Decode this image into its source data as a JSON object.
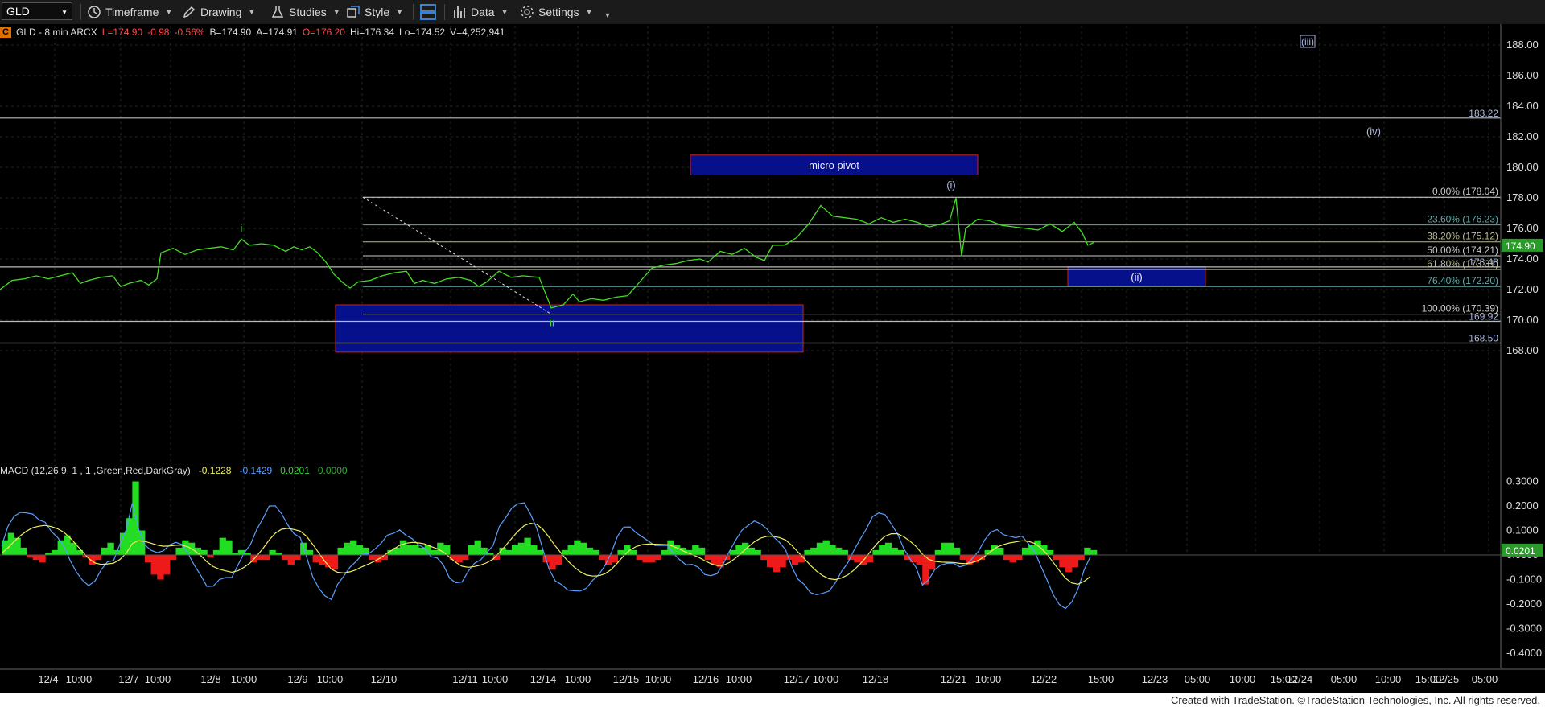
{
  "toolbar": {
    "symbol": "GLD",
    "items": [
      {
        "label": "Timeframe",
        "icon": "clock-icon"
      },
      {
        "label": "Drawing",
        "icon": "pencil-icon"
      },
      {
        "label": "Studies",
        "icon": "flask-icon"
      },
      {
        "label": "Style",
        "icon": "style-icon"
      },
      {
        "label": "",
        "icon": "layout-icon"
      },
      {
        "label": "Data",
        "icon": "bar-chart-icon"
      },
      {
        "label": "Settings",
        "icon": "gear-icon"
      }
    ]
  },
  "info": {
    "badge": "C",
    "name": "GLD - 8 min  ARCX",
    "last": "L=174.90",
    "chg": "-0.98",
    "pct": "-0.56%",
    "bid": "B=174.90",
    "ask": "A=174.91",
    "open": "O=176.20",
    "high": "Hi=176.34",
    "low": "Lo=174.52",
    "vol": "V=4,252,941"
  },
  "macd_header": {
    "label": "MACD (12,26,9, 1 , 1 ,Green,Red,DarkGray)",
    "v1": "-0.1228",
    "v2": "-0.1429",
    "v3": "0.0201",
    "v4": "0.0000"
  },
  "colors": {
    "price": "#44dd22",
    "box": "#05108a",
    "box_border": "#cc2222",
    "macd_pos": "#22dd22",
    "macd_neg": "#ee1a1a",
    "macd_line": "#5aa0ff",
    "signal_line": "#f0f060"
  },
  "chart_data": {
    "type": "line",
    "symbol": "GLD",
    "interval": "8 min",
    "y_axis": {
      "ticks": [
        "188.00",
        "186.00",
        "184.00",
        "182.00",
        "180.00",
        "178.00",
        "176.00",
        "174.00",
        "172.00",
        "170.00",
        "168.00"
      ],
      "range": [
        166.5,
        189.2
      ]
    },
    "x_ticks": [
      "12/4",
      "10:00",
      "12/7",
      "10:00",
      "12/8",
      "10:00",
      "12/9",
      "10:00",
      "12/10",
      "12/11",
      "10:00",
      "12/14",
      "10:00",
      "12/15",
      "10:00",
      "12/16",
      "10:00",
      "12/17",
      "10:00",
      "12/18",
      "12/21",
      "10:00",
      "12/22",
      "15:00",
      "12/23",
      "05:00",
      "10:00",
      "15:00",
      "12/24",
      "05:00",
      "10:00",
      "15:00",
      "12/25",
      "05:00"
    ],
    "price_path": [
      [
        0,
        172.0
      ],
      [
        15,
        172.6
      ],
      [
        30,
        172.7
      ],
      [
        45,
        172.9
      ],
      [
        60,
        172.7
      ],
      [
        75,
        172.9
      ],
      [
        90,
        173.1
      ],
      [
        100,
        172.4
      ],
      [
        110,
        172.6
      ],
      [
        125,
        172.8
      ],
      [
        140,
        172.9
      ],
      [
        150,
        172.2
      ],
      [
        160,
        172.4
      ],
      [
        175,
        172.6
      ],
      [
        185,
        172.3
      ],
      [
        195,
        172.7
      ],
      [
        200,
        174.4
      ],
      [
        215,
        174.7
      ],
      [
        230,
        174.3
      ],
      [
        245,
        174.6
      ],
      [
        260,
        174.7
      ],
      [
        275,
        174.8
      ],
      [
        290,
        174.6
      ],
      [
        300,
        175.3
      ],
      [
        310,
        174.9
      ],
      [
        325,
        175.0
      ],
      [
        340,
        174.9
      ],
      [
        355,
        174.5
      ],
      [
        365,
        174.8
      ],
      [
        375,
        174.6
      ],
      [
        385,
        174.8
      ],
      [
        395,
        174.4
      ],
      [
        405,
        173.8
      ],
      [
        415,
        173.0
      ],
      [
        425,
        172.5
      ],
      [
        435,
        172.1
      ],
      [
        445,
        172.5
      ],
      [
        460,
        172.6
      ],
      [
        475,
        172.9
      ],
      [
        490,
        173.1
      ],
      [
        505,
        173.2
      ],
      [
        515,
        172.4
      ],
      [
        525,
        172.6
      ],
      [
        540,
        172.4
      ],
      [
        555,
        172.7
      ],
      [
        570,
        172.8
      ],
      [
        585,
        172.6
      ],
      [
        595,
        172.2
      ],
      [
        605,
        172.5
      ],
      [
        620,
        173.2
      ],
      [
        635,
        172.8
      ],
      [
        650,
        172.9
      ],
      [
        670,
        172.8
      ],
      [
        685,
        170.8
      ],
      [
        700,
        171.0
      ],
      [
        712,
        171.7
      ],
      [
        720,
        171.2
      ],
      [
        735,
        171.4
      ],
      [
        750,
        171.3
      ],
      [
        765,
        171.5
      ],
      [
        780,
        171.6
      ],
      [
        795,
        172.5
      ],
      [
        810,
        173.4
      ],
      [
        825,
        173.6
      ],
      [
        840,
        173.7
      ],
      [
        855,
        173.9
      ],
      [
        870,
        174.0
      ],
      [
        880,
        173.8
      ],
      [
        895,
        174.5
      ],
      [
        910,
        174.3
      ],
      [
        925,
        174.7
      ],
      [
        940,
        174.1
      ],
      [
        950,
        173.9
      ],
      [
        960,
        174.9
      ],
      [
        975,
        174.9
      ],
      [
        990,
        175.4
      ],
      [
        1005,
        176.3
      ],
      [
        1020,
        177.5
      ],
      [
        1035,
        176.8
      ],
      [
        1050,
        176.7
      ],
      [
        1065,
        176.6
      ],
      [
        1080,
        176.3
      ],
      [
        1095,
        176.7
      ],
      [
        1110,
        176.4
      ],
      [
        1125,
        176.6
      ],
      [
        1140,
        176.4
      ],
      [
        1155,
        176.1
      ],
      [
        1170,
        176.3
      ],
      [
        1180,
        176.5
      ],
      [
        1188,
        178.0
      ],
      [
        1192,
        175.8
      ],
      [
        1195,
        174.2
      ],
      [
        1200,
        176.0
      ],
      [
        1215,
        176.6
      ],
      [
        1230,
        176.5
      ],
      [
        1245,
        176.2
      ],
      [
        1260,
        176.1
      ],
      [
        1275,
        176.0
      ],
      [
        1290,
        175.9
      ],
      [
        1305,
        176.3
      ],
      [
        1320,
        175.8
      ],
      [
        1335,
        176.4
      ],
      [
        1345,
        175.7
      ],
      [
        1352,
        174.9
      ],
      [
        1360,
        175.1
      ]
    ],
    "last_price": "174.90",
    "price_levels": [
      {
        "label": "183.22",
        "value": 183.22
      },
      {
        "label": "173.48",
        "value": 173.48
      },
      {
        "label": "169.92",
        "value": 169.92
      },
      {
        "label": "168.50",
        "value": 168.5
      }
    ],
    "fib_retracement": [
      {
        "label": "0.00% (178.04)",
        "value": 178.04
      },
      {
        "label": "23.60% (176.23)",
        "value": 176.23
      },
      {
        "label": "38.20% (175.12)",
        "value": 175.12
      },
      {
        "label": "50.00% (174.21)",
        "value": 174.21
      },
      {
        "label": "61.80% (173.31)",
        "value": 173.31
      },
      {
        "label": "76.40% (172.20)",
        "value": 172.2
      },
      {
        "label": "100.00% (170.39)",
        "value": 170.39
      }
    ],
    "zones": [
      {
        "label": "micro pivot",
        "x0": 858,
        "x1": 1215,
        "top": 180.8,
        "bottom": 179.5
      },
      {
        "label": "(ii)",
        "x0": 1327,
        "x1": 1498,
        "top": 173.5,
        "bottom": 172.2
      },
      {
        "label": "",
        "x0": 417,
        "x1": 998,
        "top": 171.0,
        "bottom": 167.9
      }
    ],
    "wave_labels": [
      {
        "text": "i",
        "x": 300,
        "value": 175.8,
        "color": "#44dd22"
      },
      {
        "text": "ii",
        "x": 686,
        "value": 169.6,
        "color": "#44dd22"
      },
      {
        "text": "(i)",
        "x": 1182,
        "value": 178.6,
        "color": "#aab4e0"
      },
      {
        "text": "(iii)",
        "x": 1625,
        "value": 188.0,
        "color": "#aab4e0"
      },
      {
        "text": "(iv)",
        "x": 1707,
        "value": 182.1,
        "color": "#aab4e0"
      }
    ],
    "macd": {
      "ticks": [
        "0.3000",
        "0.2000",
        "0.1000",
        "0.0000",
        "-0.1000",
        "-0.2000",
        "-0.3000",
        "-0.4000"
      ],
      "range": [
        -0.45,
        0.32
      ],
      "last_hist": "0.0201",
      "histogram": [
        0.06,
        0.09,
        0.07,
        0.03,
        -0.01,
        -0.02,
        -0.03,
        0.01,
        0.02,
        0.06,
        0.08,
        0.05,
        0.02,
        -0.01,
        -0.04,
        -0.02,
        0.03,
        0.05,
        0.02,
        0.09,
        0.15,
        0.3,
        0.1,
        -0.03,
        -0.08,
        -0.1,
        -0.08,
        -0.02,
        0.03,
        0.06,
        0.05,
        0.03,
        0.02,
        -0.01,
        0.02,
        0.07,
        0.06,
        0.01,
        0.02,
        0.01,
        -0.03,
        -0.02,
        -0.02,
        0.02,
        0.01,
        -0.02,
        -0.04,
        -0.02,
        0.05,
        0.02,
        -0.03,
        -0.04,
        -0.05,
        -0.06,
        0.03,
        0.05,
        0.06,
        0.04,
        0.03,
        -0.02,
        -0.03,
        -0.02,
        0.02,
        0.03,
        0.06,
        0.04,
        0.04,
        0.03,
        0.04,
        0.02,
        0.05,
        0.04,
        -0.02,
        -0.03,
        -0.02,
        0.04,
        0.06,
        0.03,
        0.01,
        -0.02,
        0.03,
        0.02,
        0.04,
        0.05,
        0.07,
        0.04,
        0.02,
        -0.03,
        -0.06,
        -0.04,
        0.02,
        0.04,
        0.06,
        0.05,
        0.03,
        0.02,
        -0.02,
        -0.04,
        -0.03,
        0.02,
        0.04,
        0.02,
        -0.02,
        -0.03,
        -0.03,
        -0.02,
        0.02,
        0.06,
        0.04,
        0.03,
        0.02,
        0.04,
        0.03,
        -0.02,
        -0.04,
        -0.05,
        -0.02,
        0.02,
        0.04,
        0.05,
        0.03,
        0.02,
        -0.02,
        -0.05,
        -0.07,
        -0.05,
        -0.02,
        -0.04,
        -0.03,
        0.02,
        0.03,
        0.05,
        0.06,
        0.04,
        0.03,
        0.02,
        -0.02,
        -0.03,
        -0.04,
        -0.03,
        0.02,
        0.04,
        0.05,
        0.03,
        0.02,
        -0.02,
        -0.03,
        -0.04,
        -0.12,
        -0.06,
        0.02,
        0.05,
        0.05,
        0.03,
        -0.02,
        -0.04,
        -0.03,
        -0.02,
        0.02,
        0.04,
        0.03,
        -0.02,
        -0.03,
        -0.02,
        0.03,
        0.04,
        0.06,
        0.04,
        0.02,
        -0.02,
        -0.05,
        -0.07,
        -0.05,
        -0.02,
        0.03,
        0.02
      ]
    }
  }
}
